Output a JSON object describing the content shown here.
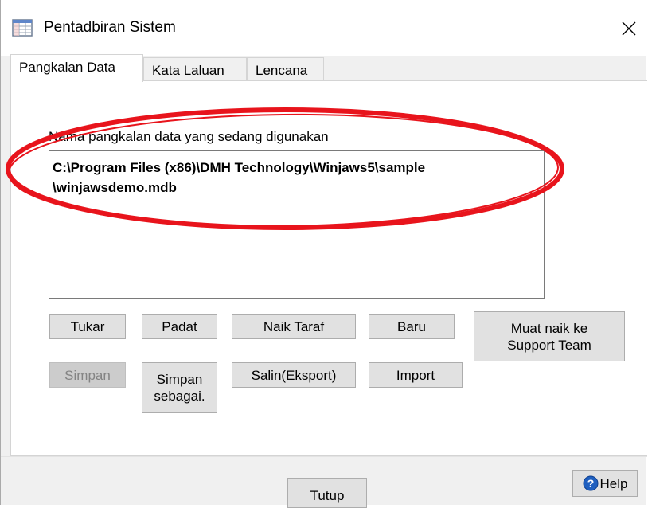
{
  "window": {
    "title": "Pentadbiran Sistem",
    "close_symbol": "✕",
    "icon": "table-window-icon"
  },
  "tabs": [
    {
      "label": "Pangkalan Data",
      "active": true
    },
    {
      "label": "Kata Laluan",
      "active": false
    },
    {
      "label": "Lencana",
      "active": false
    }
  ],
  "database": {
    "label": "Nama pangkalan data yang sedang digunakan",
    "path_line1": "C:\\Program Files (x86)\\DMH Technology\\Winjaws5\\sample",
    "path_line2": "\\winjawsdemo.mdb"
  },
  "buttons": {
    "tukar": "Tukar",
    "padat": "Padat",
    "naik_taraf": "Naik Taraf",
    "baru": "Baru",
    "muat_naik_1": "Muat naik ke",
    "muat_naik_2": "Support Team",
    "simpan": "Simpan",
    "simpan_sebagai_1": "Simpan",
    "simpan_sebagai_2": "sebagai.",
    "salin": "Salin(Eksport)",
    "import": "Import",
    "tutup": "Tutup",
    "help": "Help"
  },
  "colors": {
    "annotation_ellipse": "#e8141c",
    "help_icon": "#1f5fbf"
  }
}
